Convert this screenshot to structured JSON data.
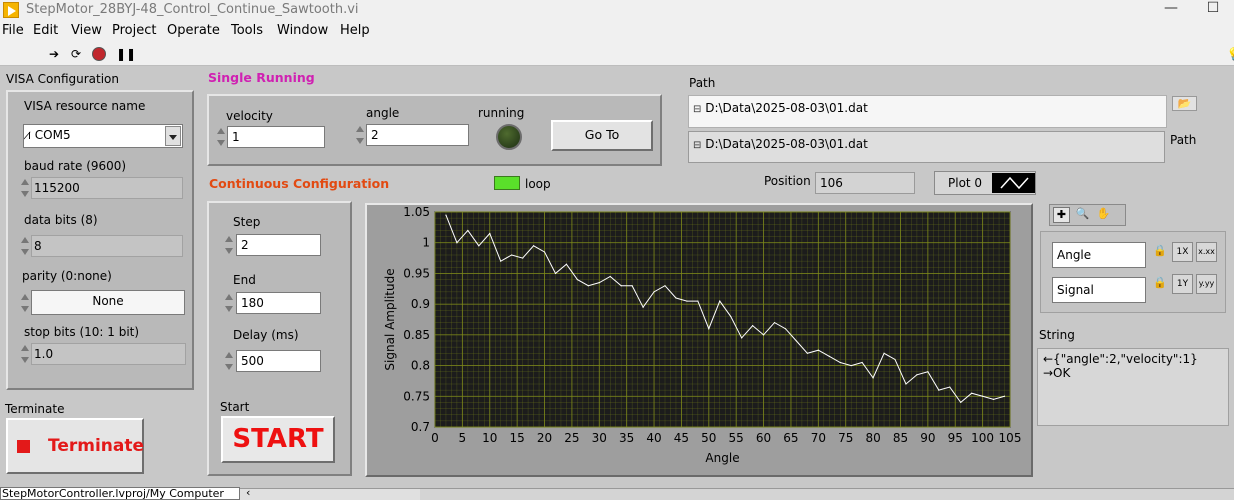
{
  "window": {
    "title": "StepMotor_28BYJ-48_Control_Continue_Sawtooth.vi"
  },
  "menu": [
    "File",
    "Edit",
    "View",
    "Project",
    "Operate",
    "Tools",
    "Window",
    "Help"
  ],
  "visa": {
    "title": "VISA Configuration",
    "resource_label": "VISA resource name",
    "resource_value": "COM5",
    "baud_label": "baud rate (9600)",
    "baud_value": "115200",
    "databits_label": "data bits (8)",
    "databits_value": "8",
    "parity_label": "parity (0:none)",
    "parity_value": "None",
    "stopbits_label": "stop bits (10: 1 bit)",
    "stopbits_value": "1.0"
  },
  "terminate": {
    "label": "Terminate",
    "button": "Terminate"
  },
  "single": {
    "title": "Single Running",
    "velocity_label": "velocity",
    "velocity_value": "1",
    "angle_label": "angle",
    "angle_value": "2",
    "running_label": "running",
    "goto_label": "Go To"
  },
  "path": {
    "label": "Path",
    "label2": "Path",
    "value1": "D:\\Data\\2025-08-03\\01.dat",
    "value2": "D:\\Data\\2025-08-03\\01.dat"
  },
  "continuous": {
    "title": "Continuous Configuration",
    "loop_label": "loop",
    "step_label": "Step",
    "step_value": "2",
    "end_label": "End",
    "end_value": "180",
    "delay_label": "Delay (ms)",
    "delay_value": "500",
    "start_label": "Start",
    "start_button": "START"
  },
  "position": {
    "label": "Position",
    "value": "106"
  },
  "plot_legend": {
    "label": "Plot 0"
  },
  "scales": {
    "x_name": "Angle",
    "y_name": "Signal"
  },
  "string_panel": {
    "label": "String",
    "line1": "←{\"angle\":2,\"velocity\":1}",
    "line2": "→OK"
  },
  "statusbar": {
    "text": "StepMotorController.lvproj/My Computer"
  },
  "colors": {
    "plot_bg": "#1c1c1c",
    "grid": "#7f8b1a",
    "trace": "#ffffff",
    "header_orange": "#e24a12",
    "header_magenta": "#d021b2"
  },
  "chart_data": {
    "type": "line",
    "xlabel": "Angle",
    "ylabel": "Signal Amplitude",
    "xlim": [
      0,
      105
    ],
    "ylim": [
      0.7,
      1.05
    ],
    "x_ticks": [
      0,
      5,
      10,
      15,
      20,
      25,
      30,
      35,
      40,
      45,
      50,
      55,
      60,
      65,
      70,
      75,
      80,
      85,
      90,
      95,
      100,
      105
    ],
    "y_ticks": [
      0.7,
      0.75,
      0.8,
      0.85,
      0.9,
      0.95,
      1,
      1.05
    ],
    "grid": true,
    "series": [
      {
        "x": [
          2,
          4,
          6,
          8,
          10,
          12,
          14,
          16,
          18,
          20,
          22,
          24,
          26,
          28,
          30,
          32,
          34,
          36,
          38,
          40,
          42,
          44,
          46,
          48,
          50,
          52,
          54,
          56,
          58,
          60,
          62,
          64,
          66,
          68,
          70,
          72,
          74,
          76,
          78,
          80,
          82,
          84,
          86,
          88,
          90,
          92,
          94,
          96,
          98,
          100,
          102,
          104
        ],
        "values": [
          1.045,
          1.0,
          1.02,
          0.995,
          1.015,
          0.97,
          0.98,
          0.975,
          0.995,
          0.985,
          0.95,
          0.965,
          0.94,
          0.93,
          0.935,
          0.945,
          0.93,
          0.93,
          0.895,
          0.92,
          0.93,
          0.91,
          0.905,
          0.905,
          0.86,
          0.905,
          0.88,
          0.845,
          0.865,
          0.85,
          0.87,
          0.86,
          0.84,
          0.82,
          0.825,
          0.815,
          0.805,
          0.8,
          0.805,
          0.78,
          0.82,
          0.81,
          0.77,
          0.785,
          0.79,
          0.76,
          0.765,
          0.74,
          0.755,
          0.75,
          0.745,
          0.75
        ]
      }
    ]
  }
}
